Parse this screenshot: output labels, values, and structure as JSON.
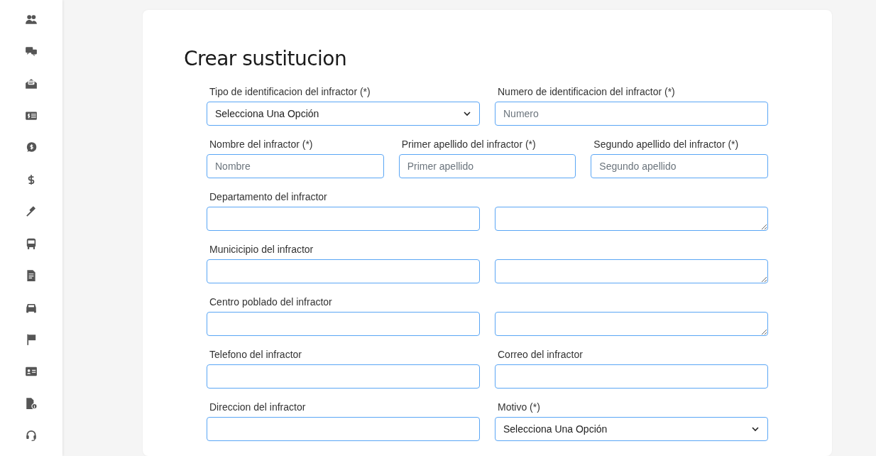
{
  "page": {
    "title": "Crear sustitucion"
  },
  "form": {
    "rows": [
      {
        "fields": [
          {
            "kind": "select",
            "label": "Tipo de identificacion del infractor (*)",
            "value": "Selecciona Una Opción"
          },
          {
            "kind": "input",
            "label": "Numero de identificacion del infractor (*)",
            "placeholder": "Numero"
          }
        ]
      },
      {
        "fields": [
          {
            "kind": "input",
            "label": "Nombre del infractor (*)",
            "placeholder": "Nombre"
          },
          {
            "kind": "input",
            "label": "Primer apellido del infractor (*)",
            "placeholder": "Primer apellido"
          },
          {
            "kind": "input",
            "label": "Segundo apellido del infractor (*)",
            "placeholder": "Segundo apellido"
          }
        ]
      },
      {
        "fields": [
          {
            "kind": "input",
            "label": "Departamento del infractor"
          },
          {
            "kind": "textarea"
          }
        ]
      },
      {
        "fields": [
          {
            "kind": "input",
            "label": "Municicipio del infractor"
          },
          {
            "kind": "textarea"
          }
        ]
      },
      {
        "fields": [
          {
            "kind": "input",
            "label": "Centro poblado del infractor"
          },
          {
            "kind": "textarea"
          }
        ]
      },
      {
        "fields": [
          {
            "kind": "input",
            "label": "Telefono del infractor"
          },
          {
            "kind": "input",
            "label": "Correo del infractor"
          }
        ]
      },
      {
        "fields": [
          {
            "kind": "input",
            "label": "Direccion del infractor"
          },
          {
            "kind": "select",
            "label": "Motivo (*)",
            "value": "Selecciona Una Opción"
          }
        ]
      }
    ]
  }
}
